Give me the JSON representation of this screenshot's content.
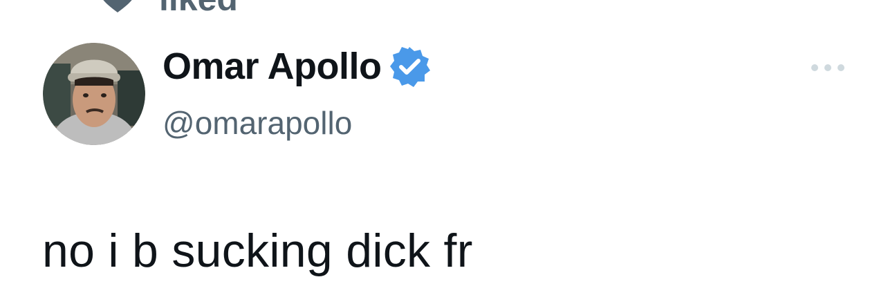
{
  "social_context": {
    "icon": "heart-icon",
    "text": "liked"
  },
  "author": {
    "display_name": "Omar Apollo",
    "handle": "@omarapollo",
    "verified": true,
    "verified_badge_color": "#4a99e9",
    "avatar": "profile-photo"
  },
  "tweet": {
    "text": "no i b sucking dick fr"
  },
  "actions": {
    "more_icon": "more-options-icon"
  },
  "colors": {
    "primary_text": "#0f1419",
    "secondary_text": "#536471",
    "background": "#ffffff"
  }
}
